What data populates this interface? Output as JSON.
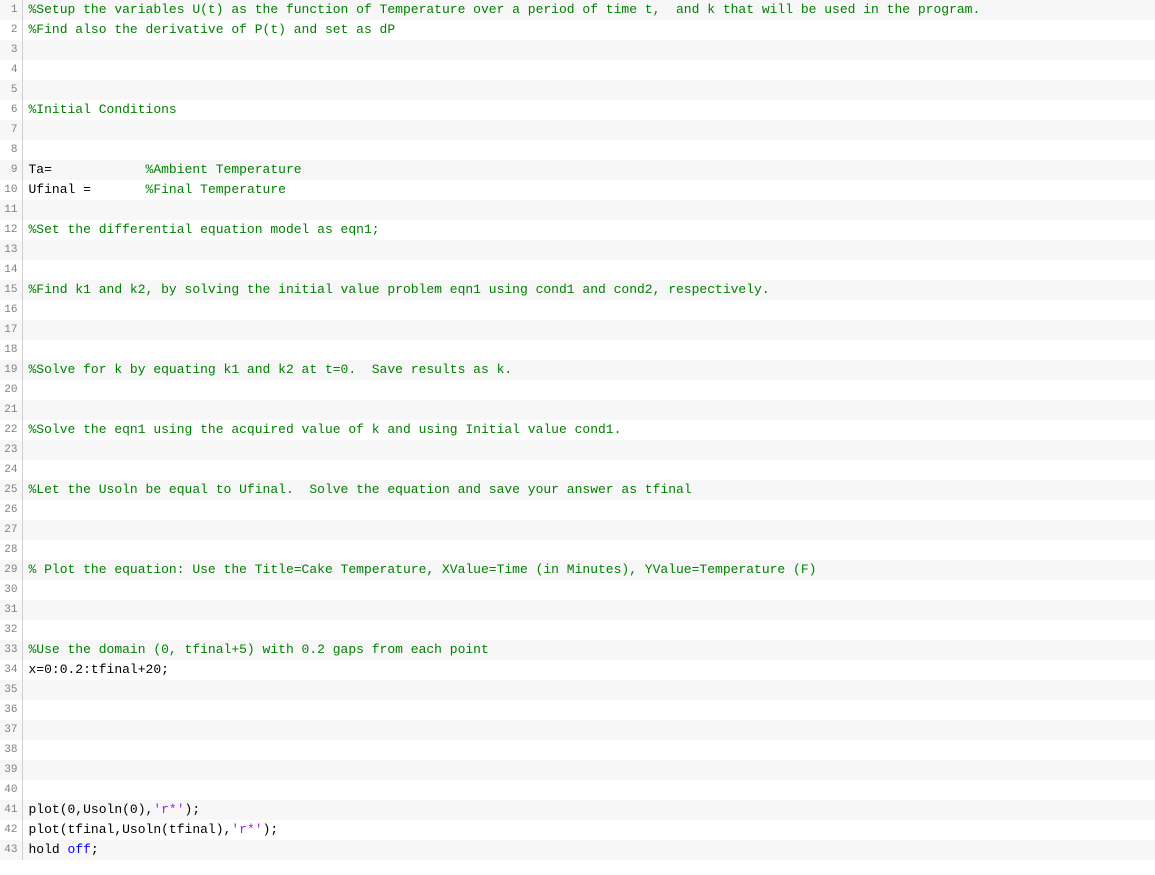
{
  "lines": [
    {
      "n": 1,
      "segments": [
        {
          "cls": "comment",
          "text": "%Setup the variables U(t) as the function of Temperature over a period of time t,  and k that will be used in the program."
        }
      ]
    },
    {
      "n": 2,
      "segments": [
        {
          "cls": "comment",
          "text": "%Find also the derivative of P(t) and set as dP"
        }
      ]
    },
    {
      "n": 3,
      "segments": []
    },
    {
      "n": 4,
      "segments": []
    },
    {
      "n": 5,
      "segments": []
    },
    {
      "n": 6,
      "segments": [
        {
          "cls": "comment",
          "text": "%Initial Conditions"
        }
      ]
    },
    {
      "n": 7,
      "segments": []
    },
    {
      "n": 8,
      "segments": []
    },
    {
      "n": 9,
      "segments": [
        {
          "cls": "ident",
          "text": "Ta=            "
        },
        {
          "cls": "comment",
          "text": "%Ambient Temperature"
        }
      ]
    },
    {
      "n": 10,
      "segments": [
        {
          "cls": "ident",
          "text": "Ufinal =       "
        },
        {
          "cls": "comment",
          "text": "%Final Temperature"
        }
      ]
    },
    {
      "n": 11,
      "segments": []
    },
    {
      "n": 12,
      "segments": [
        {
          "cls": "comment",
          "text": "%Set the differential equation model as eqn1;"
        }
      ]
    },
    {
      "n": 13,
      "segments": []
    },
    {
      "n": 14,
      "segments": []
    },
    {
      "n": 15,
      "segments": [
        {
          "cls": "comment",
          "text": "%Find k1 and k2, by solving the initial value problem eqn1 using cond1 and cond2, respectively."
        }
      ]
    },
    {
      "n": 16,
      "segments": []
    },
    {
      "n": 17,
      "segments": []
    },
    {
      "n": 18,
      "segments": []
    },
    {
      "n": 19,
      "segments": [
        {
          "cls": "comment",
          "text": "%Solve for k by equating k1 and k2 at t=0.  Save results as k."
        }
      ]
    },
    {
      "n": 20,
      "segments": []
    },
    {
      "n": 21,
      "segments": []
    },
    {
      "n": 22,
      "segments": [
        {
          "cls": "comment",
          "text": "%Solve the eqn1 using the acquired value of k and using Initial value cond1."
        }
      ]
    },
    {
      "n": 23,
      "segments": []
    },
    {
      "n": 24,
      "segments": []
    },
    {
      "n": 25,
      "segments": [
        {
          "cls": "comment",
          "text": "%Let the Usoln be equal to Ufinal.  Solve the equation and save your answer as tfinal"
        }
      ]
    },
    {
      "n": 26,
      "segments": []
    },
    {
      "n": 27,
      "segments": []
    },
    {
      "n": 28,
      "segments": []
    },
    {
      "n": 29,
      "segments": [
        {
          "cls": "comment",
          "text": "% Plot the equation: Use the Title=Cake Temperature, XValue=Time (in Minutes), YValue=Temperature (F)"
        }
      ]
    },
    {
      "n": 30,
      "segments": []
    },
    {
      "n": 31,
      "segments": []
    },
    {
      "n": 32,
      "segments": []
    },
    {
      "n": 33,
      "segments": [
        {
          "cls": "comment",
          "text": "%Use the domain (0, tfinal+5) with 0.2 gaps from each point"
        }
      ]
    },
    {
      "n": 34,
      "segments": [
        {
          "cls": "ident",
          "text": "x=0:0.2:tfinal+20;"
        }
      ]
    },
    {
      "n": 35,
      "segments": []
    },
    {
      "n": 36,
      "segments": []
    },
    {
      "n": 37,
      "segments": []
    },
    {
      "n": 38,
      "segments": []
    },
    {
      "n": 39,
      "segments": []
    },
    {
      "n": 40,
      "segments": []
    },
    {
      "n": 41,
      "segments": [
        {
          "cls": "ident",
          "text": "plot(0,Usoln(0),"
        },
        {
          "cls": "string",
          "text": "'r*'"
        },
        {
          "cls": "ident",
          "text": ");"
        }
      ]
    },
    {
      "n": 42,
      "segments": [
        {
          "cls": "ident",
          "text": "plot(tfinal,Usoln(tfinal),"
        },
        {
          "cls": "string",
          "text": "'r*'"
        },
        {
          "cls": "ident",
          "text": ");"
        }
      ]
    },
    {
      "n": 43,
      "segments": [
        {
          "cls": "ident",
          "text": "hold "
        },
        {
          "cls": "keyword",
          "text": "off"
        },
        {
          "cls": "ident",
          "text": ";"
        }
      ]
    }
  ]
}
